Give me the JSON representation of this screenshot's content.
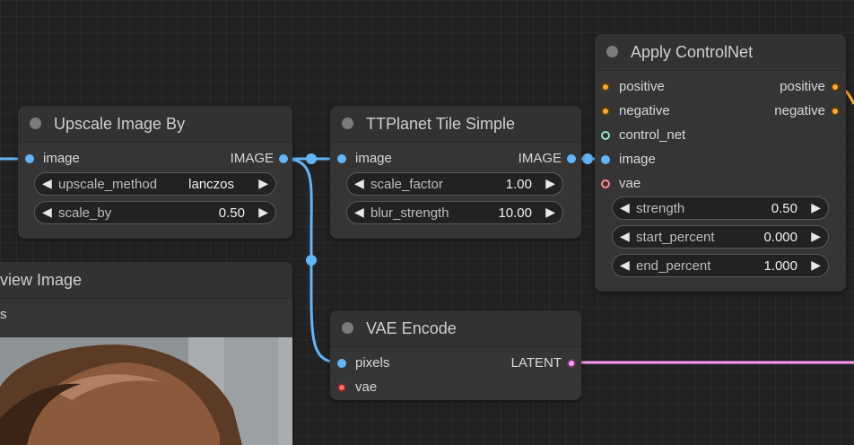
{
  "nodes": {
    "upscale": {
      "title": "Upscale Image By",
      "input_image": "image",
      "output_image": "IMAGE",
      "widgets": [
        {
          "name": "upscale_method",
          "value": "lanczos"
        },
        {
          "name": "scale_by",
          "value": "0.50"
        }
      ]
    },
    "ttplanet": {
      "title": "TTPlanet Tile Simple",
      "input_image": "image",
      "output_image": "IMAGE",
      "widgets": [
        {
          "name": "scale_factor",
          "value": "1.00"
        },
        {
          "name": "blur_strength",
          "value": "10.00"
        }
      ]
    },
    "apply_controlnet": {
      "title": "Apply ControlNet",
      "inputs": [
        "positive",
        "negative",
        "control_net",
        "image",
        "vae"
      ],
      "outputs": [
        "positive",
        "negative"
      ],
      "widgets": [
        {
          "name": "strength",
          "value": "0.50"
        },
        {
          "name": "start_percent",
          "value": "0.000"
        },
        {
          "name": "end_percent",
          "value": "1.000"
        }
      ]
    },
    "vae_encode": {
      "title": "VAE Encode",
      "inputs": [
        "pixels",
        "vae"
      ],
      "output": "LATENT"
    },
    "preview": {
      "title": "view Image",
      "subtitle": "s"
    }
  },
  "colors": {
    "image_link": "#64b5f6",
    "latent_link": "#ff9cf9",
    "conditioning_link": "#ffa931"
  }
}
